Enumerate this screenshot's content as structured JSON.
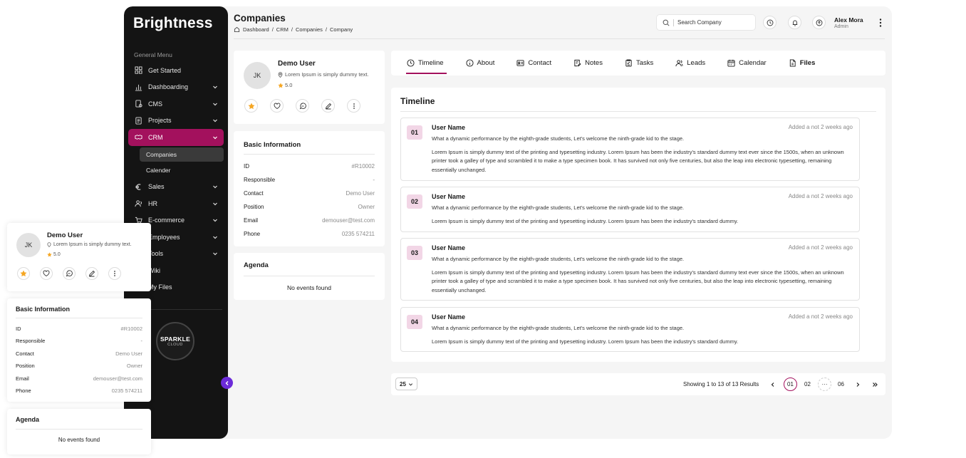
{
  "sidebar": {
    "brand": "Brightness",
    "caption": "General Menu",
    "items": [
      {
        "label": "Get Started",
        "icon": "grid-icon"
      },
      {
        "label": "Dashboarding",
        "icon": "chart-icon"
      },
      {
        "label": "CMS",
        "icon": "cms-icon"
      },
      {
        "label": "Projects",
        "icon": "projects-icon"
      },
      {
        "label": "CRM",
        "icon": "handshake-icon"
      },
      {
        "label": "Sales",
        "icon": "euro-icon"
      },
      {
        "label": "HR",
        "icon": "people-icon"
      },
      {
        "label": "E-commerce",
        "icon": "cart-icon"
      },
      {
        "label": "Employees",
        "icon": "employees-icon"
      },
      {
        "label": "Tools",
        "icon": "tools-icon"
      },
      {
        "label": "Wiki",
        "icon": "wiki-icon"
      },
      {
        "label": "My Files",
        "icon": "files-icon"
      }
    ],
    "crm_sub": [
      {
        "label": "Companies"
      },
      {
        "label": "Calender"
      }
    ],
    "sparkle": {
      "line1": "SPARKLE",
      "line2": "CLOUD"
    }
  },
  "header": {
    "title": "Companies",
    "breadcrumb": [
      "Dashboard",
      "CRM",
      "Companies",
      "Company"
    ],
    "search_placeholder": "Search Company",
    "user_name": "Alex Mora",
    "user_role": "Admin"
  },
  "profile": {
    "initials": "JK",
    "name": "Demo User",
    "location": "Lorem Ipsum is simply dummy text.",
    "rating": "5.0"
  },
  "basic_info": {
    "title": "Basic Information",
    "rows": [
      {
        "key": "ID",
        "value": "#R10002"
      },
      {
        "key": "Responsible",
        "value": "-"
      },
      {
        "key": "Contact",
        "value": "Demo User"
      },
      {
        "key": "Position",
        "value": "Owner"
      },
      {
        "key": "Email",
        "value": "demouser@test.com"
      },
      {
        "key": "Phone",
        "value": "0235 574211"
      }
    ]
  },
  "agenda": {
    "title": "Agenda",
    "empty": "No events found"
  },
  "tabs": [
    {
      "label": "Timeline",
      "icon": "clock-icon"
    },
    {
      "label": "About",
      "icon": "info-icon"
    },
    {
      "label": "Contact",
      "icon": "contact-card-icon"
    },
    {
      "label": "Notes",
      "icon": "notes-icon"
    },
    {
      "label": "Tasks",
      "icon": "tasks-icon"
    },
    {
      "label": "Leads",
      "icon": "leads-icon"
    },
    {
      "label": "Calendar",
      "icon": "calendar-icon"
    },
    {
      "label": "Files",
      "icon": "file-icon"
    }
  ],
  "timeline": {
    "title": "Timeline",
    "items": [
      {
        "num": "01",
        "user": "User Name",
        "time": "Added a not 2 weeks ago",
        "sub": "What a dynamic performance by the eighth-grade students, Let's welcome the ninth-grade kid to the stage.",
        "body": "Lorem Ipsum is simply dummy text of the printing and  typesetting industry. Lorem Ipsum has been the industry's standard dummy  text ever since the 1500s, when an unknown printer took a galley of  type and scrambled it to make a type specimen book. It has survived not  only five centuries, but also the leap into electronic typesetting,  remaining essentially unchanged."
      },
      {
        "num": "02",
        "user": "User Name",
        "time": "Added a not 2 weeks ago",
        "sub": "What a dynamic performance by the eighth-grade students, Let's welcome the ninth-grade kid to the stage.",
        "body": "Lorem Ipsum is simply dummy text of the printing and  typesetting industry. Lorem Ipsum has been the industry's standard dummy."
      },
      {
        "num": "03",
        "user": "User Name",
        "time": "Added a not 2 weeks ago",
        "sub": "What a dynamic performance by the eighth-grade students, Let's welcome the ninth-grade kid to the stage.",
        "body": "Lorem Ipsum is simply dummy text of the printing and  typesetting industry. Lorem Ipsum has been the industry's standard dummy  text ever since the 1500s, when an unknown printer took a galley of  type and scrambled it to make a type specimen book. It has survived not  only five centuries, but also the leap into electronic typesetting,  remaining essentially unchanged."
      },
      {
        "num": "04",
        "user": "User Name",
        "time": "Added a not 2 weeks ago",
        "sub": "What a dynamic performance by the eighth-grade students, Let's welcome the ninth-grade kid to the stage.",
        "body": "Lorem Ipsum is simply dummy text of the printing and  typesetting industry. Lorem Ipsum has been the industry's standard dummy."
      }
    ]
  },
  "pagination": {
    "page_size": "25",
    "showing": "Showing 1 to 13 of 13 Results",
    "pages": [
      "01",
      "02",
      "06"
    ]
  },
  "colors": {
    "accent": "#a3115d",
    "sidebar_bg": "#141414",
    "collapse_button": "#6c2bd9",
    "badge_bg": "#f2d6e6",
    "star": "#f5a623"
  }
}
